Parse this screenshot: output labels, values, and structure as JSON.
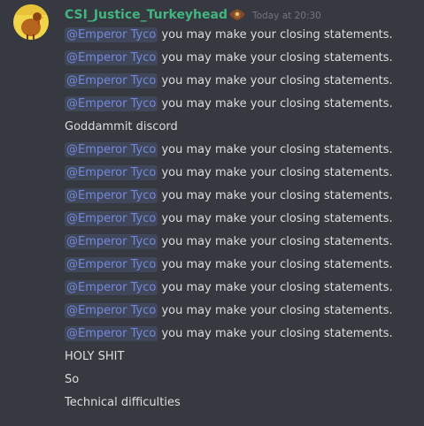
{
  "author": {
    "username": "CSI_Justice_Turkeyhead",
    "name_color": "#43b581",
    "badge_icon": "turkey-icon",
    "avatar_icon": "turkey-avatar-icon"
  },
  "timestamp": "Today at 20:30",
  "messages": [
    {
      "mention": "@Emperor Tyco",
      "text": "you may make your closing statements."
    },
    {
      "mention": "@Emperor Tyco",
      "text": "you may make your closing statements."
    },
    {
      "mention": "@Emperor Tyco",
      "text": "you may make your closing statements."
    },
    {
      "mention": "@Emperor Tyco",
      "text": "you may make your closing statements."
    },
    {
      "mention": "",
      "text": "Goddammit discord"
    },
    {
      "mention": "@Emperor Tyco",
      "text": "you may make your closing statements."
    },
    {
      "mention": "@Emperor Tyco",
      "text": "you may make your closing statements."
    },
    {
      "mention": "@Emperor Tyco",
      "text": "you may make your closing statements."
    },
    {
      "mention": "@Emperor Tyco",
      "text": "you may make your closing statements."
    },
    {
      "mention": "@Emperor Tyco",
      "text": "you may make your closing statements."
    },
    {
      "mention": "@Emperor Tyco",
      "text": "you may make your closing statements."
    },
    {
      "mention": "@Emperor Tyco",
      "text": "you may make your closing statements."
    },
    {
      "mention": "@Emperor Tyco",
      "text": "you may make your closing statements."
    },
    {
      "mention": "@Emperor Tyco",
      "text": "you may make your closing statements."
    },
    {
      "mention": "",
      "text": "HOLY SHIT"
    },
    {
      "mention": "",
      "text": "So"
    },
    {
      "mention": "",
      "text": "Technical difficulties"
    }
  ],
  "colors": {
    "background": "#36393f",
    "mention_text": "#7289da",
    "message_text": "#dcddde",
    "timestamp": "#72767d"
  }
}
